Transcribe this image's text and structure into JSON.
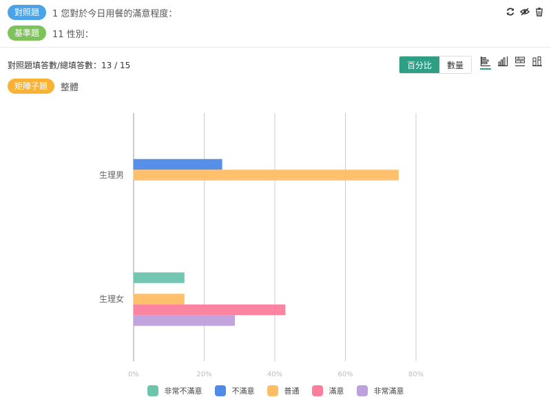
{
  "header": {
    "q1": {
      "badge": "對照題",
      "text": "1 您對於今日用餐的滿意程度：",
      "color": "#4aa3e8"
    },
    "q2": {
      "badge": "基準題",
      "text": "11 性別：",
      "color": "#7ec35a"
    }
  },
  "toolbar": {
    "icons": [
      "refresh-icon",
      "hide-icon",
      "trash-icon"
    ]
  },
  "summary": {
    "text": "對照題填答數/總填答數：13 / 15"
  },
  "toggle": {
    "percent_label": "百分比",
    "count_label": "數量"
  },
  "chart_types": [
    "horizontal-bar-icon",
    "vertical-bar-icon",
    "stacked-bar-icon",
    "grouped-bar-icon"
  ],
  "subquestion": {
    "badge": "矩陣子題",
    "text": "整體",
    "color": "#f9b234"
  },
  "chart_data": {
    "type": "bar",
    "orientation": "horizontal",
    "categories": [
      "生理男",
      "生理女"
    ],
    "series": [
      {
        "name": "非常不滿意",
        "color": "#6cc4ad",
        "values": [
          0,
          14.3
        ]
      },
      {
        "name": "不滿意",
        "color": "#4f8ae8",
        "values": [
          25,
          0
        ]
      },
      {
        "name": "普通",
        "color": "#ffbd66",
        "values": [
          75,
          14.3
        ]
      },
      {
        "name": "滿意",
        "color": "#fb7f9c",
        "values": [
          0,
          42.9
        ]
      },
      {
        "name": "非常滿意",
        "color": "#bea0dc",
        "values": [
          0,
          28.6
        ]
      }
    ],
    "xlim": [
      0,
      80
    ],
    "xticks": [
      "0%",
      "20%",
      "40%",
      "60%",
      "80%"
    ],
    "grid": true,
    "legend": "bottom"
  }
}
